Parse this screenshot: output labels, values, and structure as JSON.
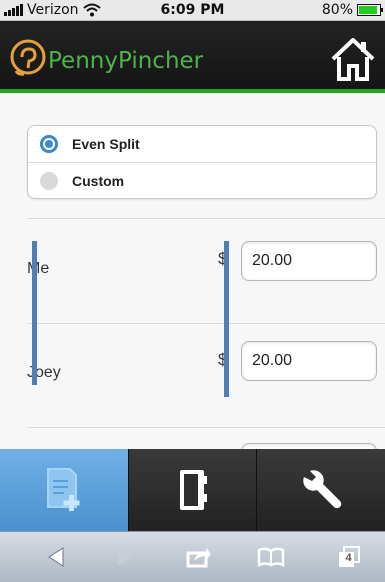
{
  "status_bar": {
    "carrier": "Verizon",
    "time": "6:09 PM",
    "battery": "80%",
    "battery_level": 0.8
  },
  "header": {
    "app_name": "PennyPincher",
    "home_icon": "home-icon",
    "accent": "#1fa51f"
  },
  "split_options": [
    {
      "label": "Even Split",
      "selected": true
    },
    {
      "label": "Custom",
      "selected": false
    }
  ],
  "people": [
    {
      "name": "Me",
      "currency": "$",
      "amount": "20.00"
    },
    {
      "name": "Joey",
      "currency": "$",
      "amount": "20.00"
    }
  ],
  "tabs": [
    {
      "icon": "add-receipt-icon",
      "active": true
    },
    {
      "icon": "address-book-icon",
      "active": false
    },
    {
      "icon": "wrench-icon",
      "active": false
    }
  ],
  "browser_toolbar": {
    "tab_count": "4"
  },
  "colors": {
    "selected_blue": "#3a89c9",
    "tab_active": "#5a9fd8"
  }
}
